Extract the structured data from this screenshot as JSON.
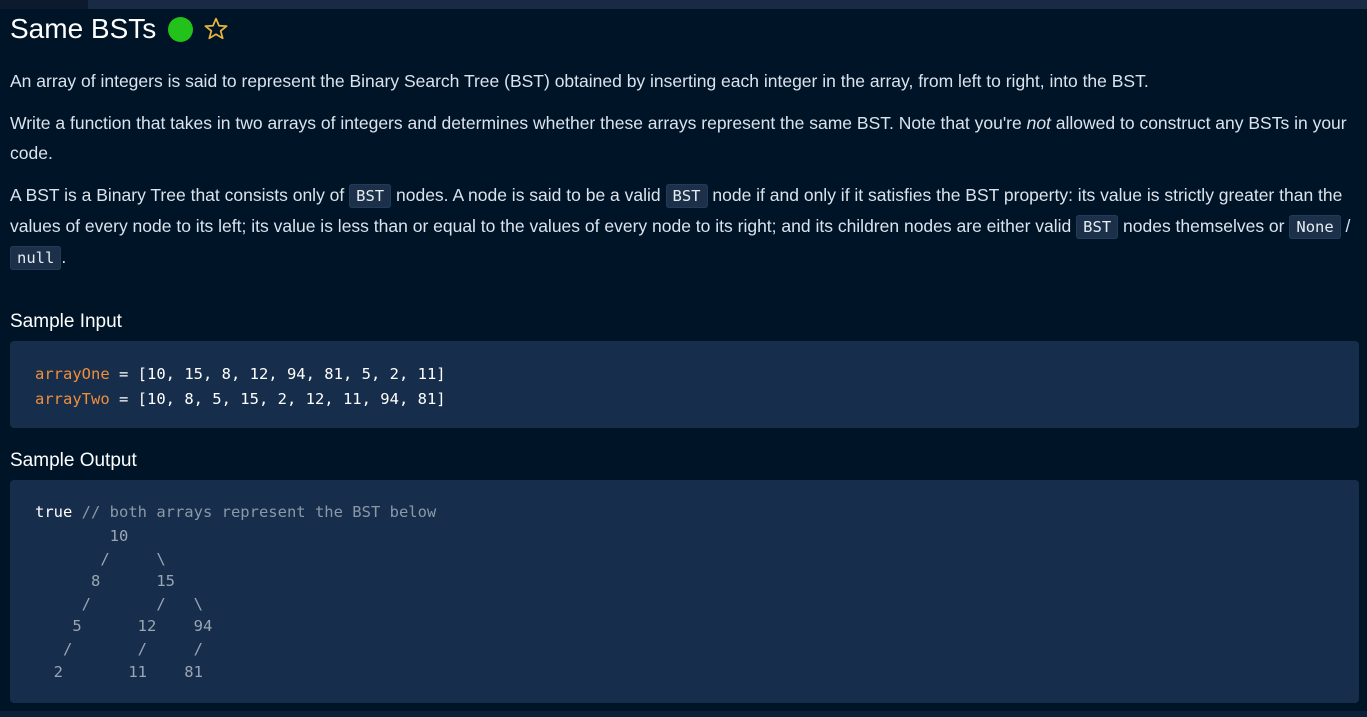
{
  "problem": {
    "title": "Same BSTs",
    "status_color": "#22c21a",
    "star_icon": "star-outline",
    "star_color": "#e8b63a"
  },
  "description": {
    "p1": "An array of integers is said to represent the Binary Search Tree (BST) obtained by inserting each integer in the array, from left to right, into the BST.",
    "p2_before": "Write a function that takes in two arrays of integers and determines whether these arrays represent the same BST. Note that you're ",
    "p2_em": "not",
    "p2_after": " allowed to construct any BSTs in your code.",
    "p3_a": "A BST is a Binary Tree that consists only of ",
    "p3_code1": "BST",
    "p3_b": " nodes. A node is said to be a valid ",
    "p3_code2": "BST",
    "p3_c": " node if and only if it satisfies the BST property: its value is strictly greater than the values of every node to its left; its value is less than or equal to the values of every node to its right; and its children nodes are either valid ",
    "p3_code3": "BST",
    "p3_d": " nodes themselves or ",
    "p3_code4": "None",
    "p3_sep": " / ",
    "p3_code5": "null",
    "p3_end": "."
  },
  "sample_input": {
    "heading": "Sample Input",
    "lines": [
      {
        "name": "arrayOne",
        "op": " = ",
        "value": "[10, 15, 8, 12, 94, 81, 5, 2, 11]"
      },
      {
        "name": "arrayTwo",
        "op": " = ",
        "value": "[10, 8, 5, 15, 2, 12, 11, 94, 81]"
      }
    ]
  },
  "sample_output": {
    "heading": "Sample Output",
    "result": "true",
    "comment": " // both arrays represent the BST below",
    "tree": "        10\n       /     \\\n      8      15\n     /       /   \\\n    5      12    94\n   /       /     /\n  2       11    81"
  }
}
